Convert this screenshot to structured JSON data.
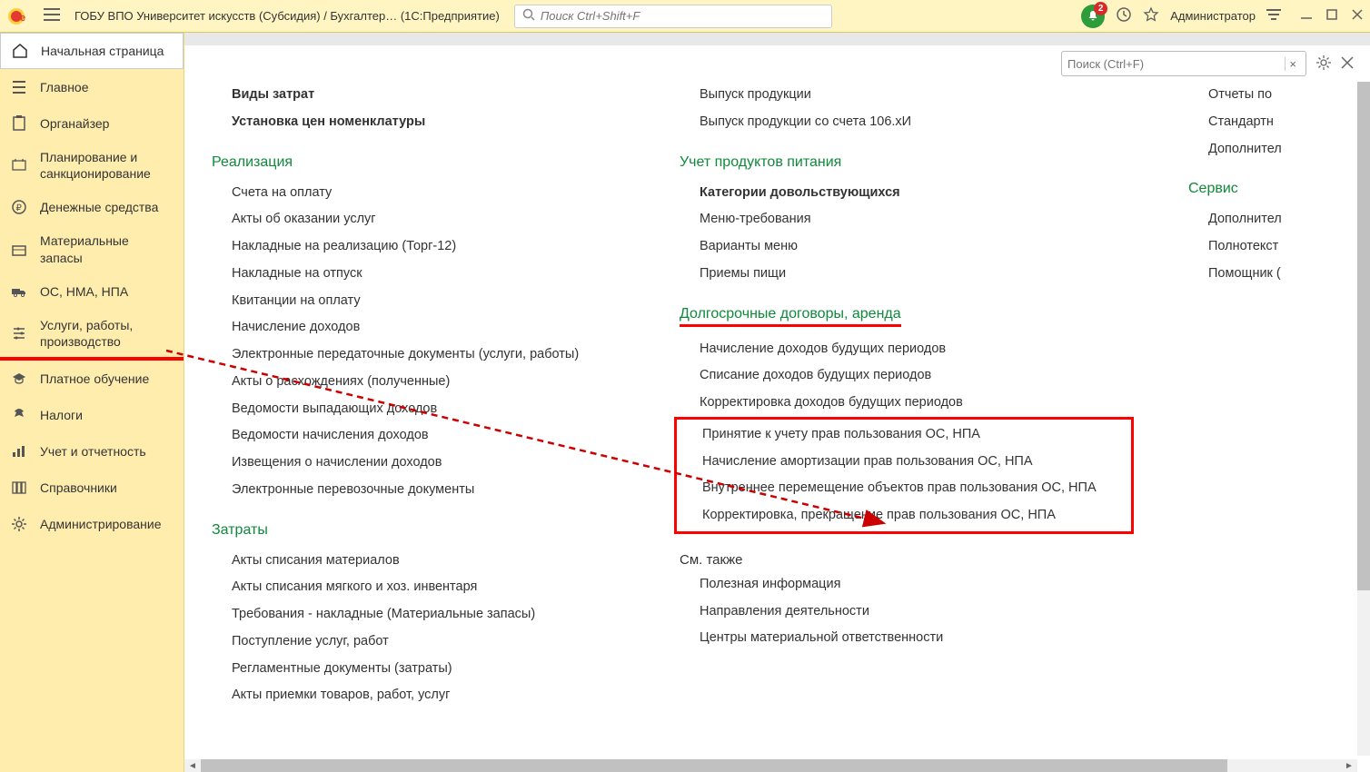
{
  "titlebar": {
    "title": "ГОБУ ВПО Университет искусств (Субсидия) / Бухгалтер…   (1С:Предприятие)",
    "global_search_placeholder": "Поиск Ctrl+Shift+F",
    "badge_count": "2",
    "admin_label": "Администратор"
  },
  "sidebar": {
    "items": [
      {
        "label": "Начальная страница",
        "icon": "home"
      },
      {
        "label": "Главное",
        "icon": "list"
      },
      {
        "label": "Органайзер",
        "icon": "clipboard"
      },
      {
        "label": "Планирование и санкционирование",
        "icon": "plan"
      },
      {
        "label": "Денежные средства",
        "icon": "ruble"
      },
      {
        "label": "Материальные запасы",
        "icon": "box"
      },
      {
        "label": "ОС, НМА, НПА",
        "icon": "truck"
      },
      {
        "label": "Услуги, работы, производство",
        "icon": "sliders"
      },
      {
        "label": "Платное обучение",
        "icon": "hat"
      },
      {
        "label": "Налоги",
        "icon": "eagle"
      },
      {
        "label": "Учет и отчетность",
        "icon": "chart"
      },
      {
        "label": "Справочники",
        "icon": "books"
      },
      {
        "label": "Администрирование",
        "icon": "gear"
      }
    ]
  },
  "inner_search_placeholder": "Поиск (Ctrl+F)",
  "col1": {
    "top_bold": [
      "Виды затрат",
      "Установка цен номенклатуры"
    ],
    "sec1_heading": "Реализация",
    "sec1_items": [
      "Счета на оплату",
      "Акты об оказании услуг",
      "Накладные на реализацию (Торг-12)",
      "Накладные на отпуск",
      "Квитанции на оплату",
      "Начисление доходов",
      "Электронные передаточные документы (услуги, работы)",
      "Акты о расхождениях (полученные)",
      "Ведомости выпадающих доходов",
      "Ведомости начисления доходов",
      "Извещения о начислении доходов",
      "Электронные перевозочные документы"
    ],
    "sec2_heading": "Затраты",
    "sec2_items": [
      "Акты списания материалов",
      "Акты списания мягкого и хоз. инвентаря",
      "Требования - накладные (Материальные запасы)",
      "Поступление услуг, работ",
      "Регламентные документы (затраты)",
      "Акты приемки товаров, работ, услуг"
    ]
  },
  "col2": {
    "top_items": [
      "Выпуск продукции",
      "Выпуск продукции со счета 106.хИ"
    ],
    "sec1_heading": "Учет продуктов питания",
    "sec1_bold": "Категории довольствующихся",
    "sec1_items": [
      "Меню-требования",
      "Варианты меню",
      "Приемы пищи"
    ],
    "sec2_heading": "Долгосрочные договоры, аренда",
    "sec2_items": [
      "Начисление доходов будущих периодов",
      "Списание доходов будущих периодов",
      "Корректировка доходов будущих периодов"
    ],
    "sec2_boxed_items": [
      "Принятие к учету прав пользования ОС, НПА",
      "Начисление амортизации прав пользования ОС, НПА",
      "Внутреннее перемещение объектов прав пользования ОС, НПА",
      "Корректировка, прекращение прав пользования ОС, НПА"
    ],
    "sec3_heading": "См. также",
    "sec3_items": [
      "Полезная информация",
      "Направления деятельности",
      "Центры материальной ответственности"
    ]
  },
  "col3": {
    "top_items": [
      "Отчеты по",
      "Стандартн",
      "Дополнител"
    ],
    "sec1_heading": "Сервис",
    "sec1_items": [
      "Дополнител",
      "Полнотекст",
      "Помощник ("
    ]
  }
}
